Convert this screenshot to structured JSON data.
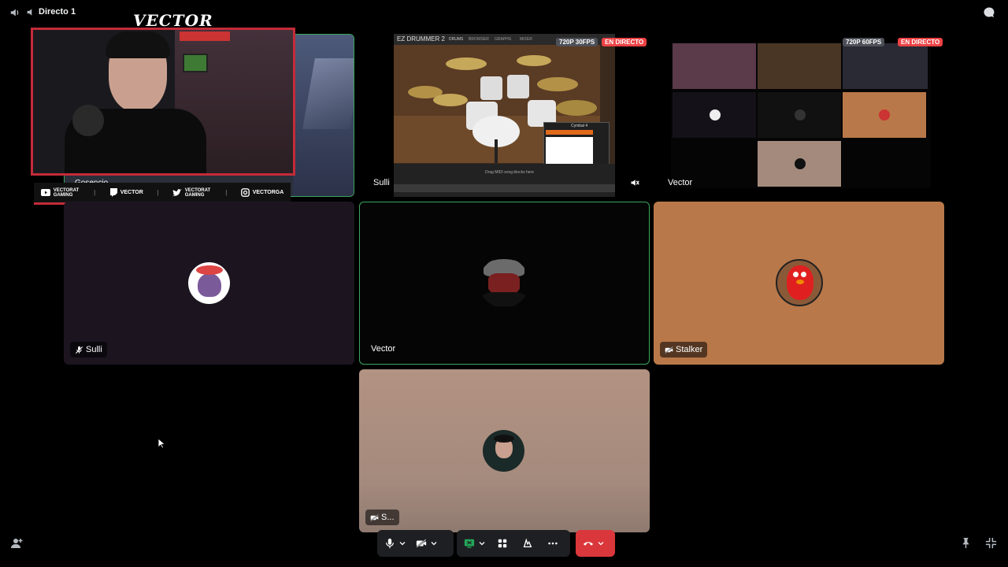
{
  "top_bar": {
    "channel_title": "Directo 1"
  },
  "overlay": {
    "logo_text": "VECTOR",
    "name_tag": "Gosencio",
    "socials": [
      {
        "icon": "youtube-icon",
        "label": "VECTORAT GAMING"
      },
      {
        "icon": "twitch-icon",
        "label": "VECTOR"
      },
      {
        "icon": "twitter-icon",
        "label": "VECTORAT GAMING"
      },
      {
        "icon": "instagram-icon",
        "label": "VECTORGA"
      }
    ]
  },
  "streams": {
    "sulli_stream": {
      "label": "Sulli",
      "quality": "720P 30FPS",
      "live": "EN DIRECTO"
    },
    "vector_stream": {
      "label": "Vector",
      "quality": "720P 60FPS",
      "live": "EN DIRECTO"
    },
    "drummer_app": {
      "app_title": "EZ DRUMMER 2",
      "tabs": [
        "DRUMS",
        "BROWSER",
        "GRAPHS",
        "MIXER"
      ],
      "drop_hint": "Drag MIDI song blocks here",
      "panel_title": "Cymbal 4"
    }
  },
  "participants": [
    {
      "name": "Sulli",
      "status": "muted"
    },
    {
      "name": "Vector",
      "status": "speaking"
    },
    {
      "name": "Stalker",
      "status": "camera-off"
    },
    {
      "name": "S...",
      "status": "camera-off"
    }
  ],
  "colors": {
    "speaking_border": "#3ba55d",
    "hangup": "#da373c",
    "overlay_red": "#c42b39",
    "screen_share_green": "#23a559"
  }
}
